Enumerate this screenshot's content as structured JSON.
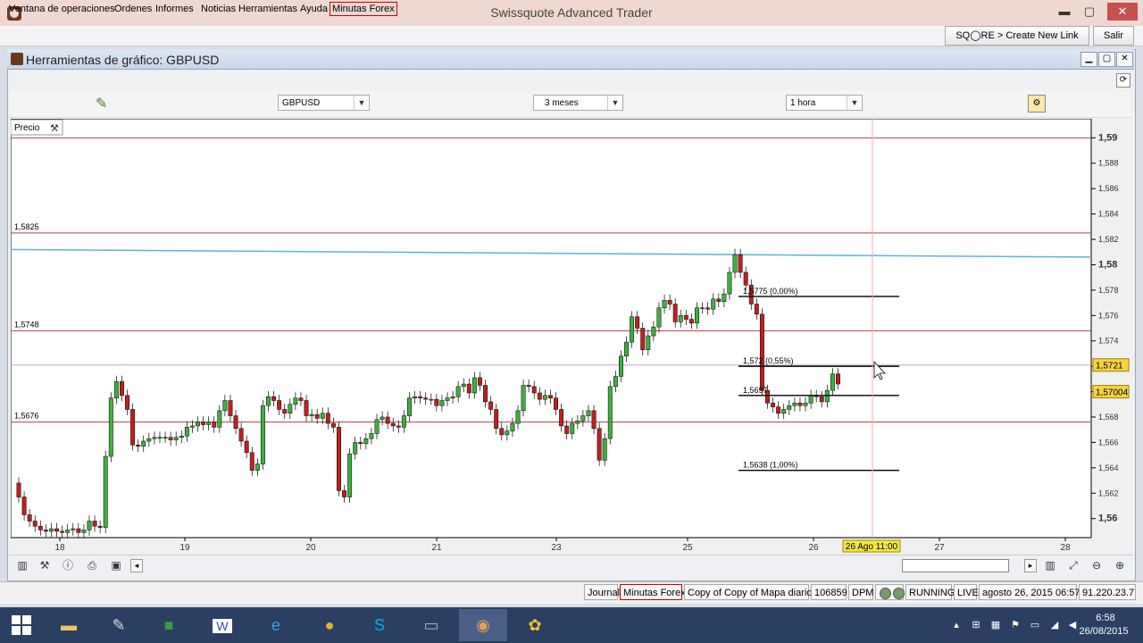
{
  "window": {
    "title": "Swissquote Advanced Trader",
    "minimize": "▬",
    "maximize": "▢",
    "close": "✕"
  },
  "menu": {
    "items": [
      "Ventana de operaciones",
      "Ordenes",
      "Informes",
      "Noticias",
      "Herramientas",
      "Ayuda",
      "Minutas Forex"
    ],
    "squore_link": "SQ◯RE > Create New Link",
    "salir": "Salir"
  },
  "chart_window": {
    "title": "Herramientas de gráfico: GBPUSD",
    "symbol": "GBPUSD",
    "period": "3 meses",
    "interval": "1 hora",
    "precio_label": "Precio"
  },
  "chart_data": {
    "type": "candlestick",
    "symbol": "GBPUSD",
    "ylim": [
      1.5585,
      1.5915
    ],
    "y_ticks": [
      "1,59",
      "1,588",
      "1,586",
      "1,584",
      "1,582",
      "1,58",
      "1,578",
      "1,576",
      "1,574",
      "1,572",
      "1,57",
      "1,568",
      "1,566",
      "1,564",
      "1,562",
      "1,56"
    ],
    "y_tick_values": [
      1.59,
      1.588,
      1.586,
      1.584,
      1.582,
      1.58,
      1.578,
      1.576,
      1.574,
      1.572,
      1.57,
      1.568,
      1.566,
      1.564,
      1.562,
      1.56
    ],
    "x_ticks": [
      "18",
      "19",
      "20",
      "21",
      "23",
      "25",
      "26",
      "27",
      "28"
    ],
    "x_tick_days": [
      0,
      1,
      2,
      3,
      4,
      5,
      6,
      7,
      8
    ],
    "horizontal_levels": [
      {
        "value": 1.59,
        "label": ""
      },
      {
        "value": 1.5825,
        "label": "1,5825"
      },
      {
        "value": 1.5748,
        "label": "1,5748"
      },
      {
        "value": 1.5721,
        "label": ""
      },
      {
        "value": 1.5676,
        "label": "1,5676"
      }
    ],
    "moving_average": {
      "from": 1.5812,
      "to": 1.5806,
      "color": "#5fb3d9"
    },
    "fibonacci": [
      {
        "value": 1.5775,
        "label": "1,5775 (0,00%)"
      },
      {
        "value": 1.572,
        "label": "1,572 (0,55%)"
      },
      {
        "value": 1.5697,
        "label": "1,5697"
      },
      {
        "value": 1.5638,
        "label": "1,5638 (1,00%)"
      }
    ],
    "price_tags": [
      {
        "value": 1.5721,
        "label": "1,5721"
      },
      {
        "value": 1.57,
        "label": "1,57004"
      }
    ],
    "crosshair_time_label": "26 Ago 11:00",
    "candle_closes": [
      1.5617,
      1.5603,
      1.5598,
      1.5594,
      1.5591,
      1.559,
      1.5592,
      1.559,
      1.5589,
      1.5591,
      1.5592,
      1.5589,
      1.5591,
      1.5598,
      1.5594,
      1.5593,
      1.5649,
      1.5695,
      1.5708,
      1.5697,
      1.5686,
      1.5658,
      1.5657,
      1.5661,
      1.5663,
      1.5664,
      1.5664,
      1.5664,
      1.5662,
      1.5664,
      1.5665,
      1.5672,
      1.5673,
      1.5676,
      1.5674,
      1.5676,
      1.5672,
      1.5685,
      1.5693,
      1.5681,
      1.5671,
      1.5661,
      1.5652,
      1.5638,
      1.5643,
      1.5689,
      1.5696,
      1.5693,
      1.5686,
      1.5683,
      1.569,
      1.5695,
      1.5693,
      1.5681,
      1.5682,
      1.5679,
      1.5683,
      1.5675,
      1.5672,
      1.5622,
      1.5617,
      1.5651,
      1.566,
      1.5659,
      1.5663,
      1.5667,
      1.5678,
      1.568,
      1.5675,
      1.5673,
      1.5672,
      1.5681,
      1.5695,
      1.5696,
      1.5695,
      1.5694,
      1.5694,
      1.5689,
      1.5693,
      1.5695,
      1.5696,
      1.5704,
      1.5706,
      1.5699,
      1.5711,
      1.5705,
      1.5692,
      1.5686,
      1.5671,
      1.5666,
      1.5669,
      1.5675,
      1.5685,
      1.5705,
      1.5704,
      1.5699,
      1.5694,
      1.5697,
      1.5695,
      1.5686,
      1.5673,
      1.5667,
      1.5675,
      1.5677,
      1.5681,
      1.5685,
      1.5671,
      1.5646,
      1.5663,
      1.5704,
      1.5712,
      1.5728,
      1.5739,
      1.5759,
      1.575,
      1.5733,
      1.5744,
      1.5751,
      1.5766,
      1.5772,
      1.5769,
      1.5755,
      1.576,
      1.5757,
      1.5754,
      1.5766,
      1.5766,
      1.5765,
      1.5773,
      1.5771,
      1.5777,
      1.5794,
      1.5808,
      1.5794,
      1.5784,
      1.5769,
      1.5761,
      1.5701,
      1.5691,
      1.5688,
      1.5683,
      1.5686,
      1.5689,
      1.5691,
      1.5689,
      1.5691,
      1.5697,
      1.5696,
      1.5692,
      1.5701,
      1.5714,
      1.5706
    ],
    "candle_opens": [
      1.5628,
      1.5617,
      1.5603,
      1.5598,
      1.5594,
      1.5591,
      1.559,
      1.5592,
      1.559,
      1.5589,
      1.5591,
      1.5592,
      1.5589,
      1.5591,
      1.5598,
      1.5594,
      1.5593,
      1.5649,
      1.5695,
      1.5708,
      1.5697,
      1.5686,
      1.5658,
      1.5657,
      1.5661,
      1.5663,
      1.5664,
      1.5664,
      1.5664,
      1.5662,
      1.5664,
      1.5665,
      1.5672,
      1.5673,
      1.5676,
      1.5674,
      1.5676,
      1.5672,
      1.5685,
      1.5693,
      1.5681,
      1.5671,
      1.5661,
      1.5652,
      1.5638,
      1.5643,
      1.5689,
      1.5696,
      1.5693,
      1.5686,
      1.5683,
      1.569,
      1.5695,
      1.5693,
      1.5681,
      1.5682,
      1.5679,
      1.5683,
      1.5675,
      1.5672,
      1.5622,
      1.5617,
      1.5651,
      1.566,
      1.5659,
      1.5663,
      1.5667,
      1.5678,
      1.568,
      1.5675,
      1.5673,
      1.5672,
      1.5681,
      1.5695,
      1.5696,
      1.5695,
      1.5694,
      1.5694,
      1.5689,
      1.5693,
      1.5695,
      1.5696,
      1.5704,
      1.5706,
      1.5699,
      1.5711,
      1.5705,
      1.5692,
      1.5686,
      1.5671,
      1.5666,
      1.5669,
      1.5675,
      1.5685,
      1.5705,
      1.5704,
      1.5699,
      1.5694,
      1.5697,
      1.5695,
      1.5686,
      1.5673,
      1.5667,
      1.5675,
      1.5677,
      1.5681,
      1.5685,
      1.5671,
      1.5646,
      1.5663,
      1.5704,
      1.5712,
      1.5728,
      1.5739,
      1.5759,
      1.575,
      1.5733,
      1.5744,
      1.5751,
      1.5766,
      1.5772,
      1.5769,
      1.5755,
      1.576,
      1.5757,
      1.5754,
      1.5766,
      1.5766,
      1.5765,
      1.5773,
      1.5771,
      1.5777,
      1.5794,
      1.5808,
      1.5794,
      1.5784,
      1.5769,
      1.5761,
      1.5701,
      1.5691,
      1.5688,
      1.5683,
      1.5686,
      1.5689,
      1.5691,
      1.5689,
      1.5691,
      1.5697,
      1.5696,
      1.5692,
      1.5701,
      1.5714,
      1.5721
    ]
  },
  "statusbar": {
    "journal": "Journal",
    "forex": "Minutas Forex",
    "copy": "Copy of Copy of Mapa diario.",
    "account": "106859",
    "dpm": "DPM",
    "running": "RUNNING",
    "live": "LIVE",
    "datetime": "agosto 26, 2015 06:57",
    "ip": "91.220.23.7"
  },
  "taskbar": {
    "time": "6:58",
    "date": "26/08/2015"
  }
}
